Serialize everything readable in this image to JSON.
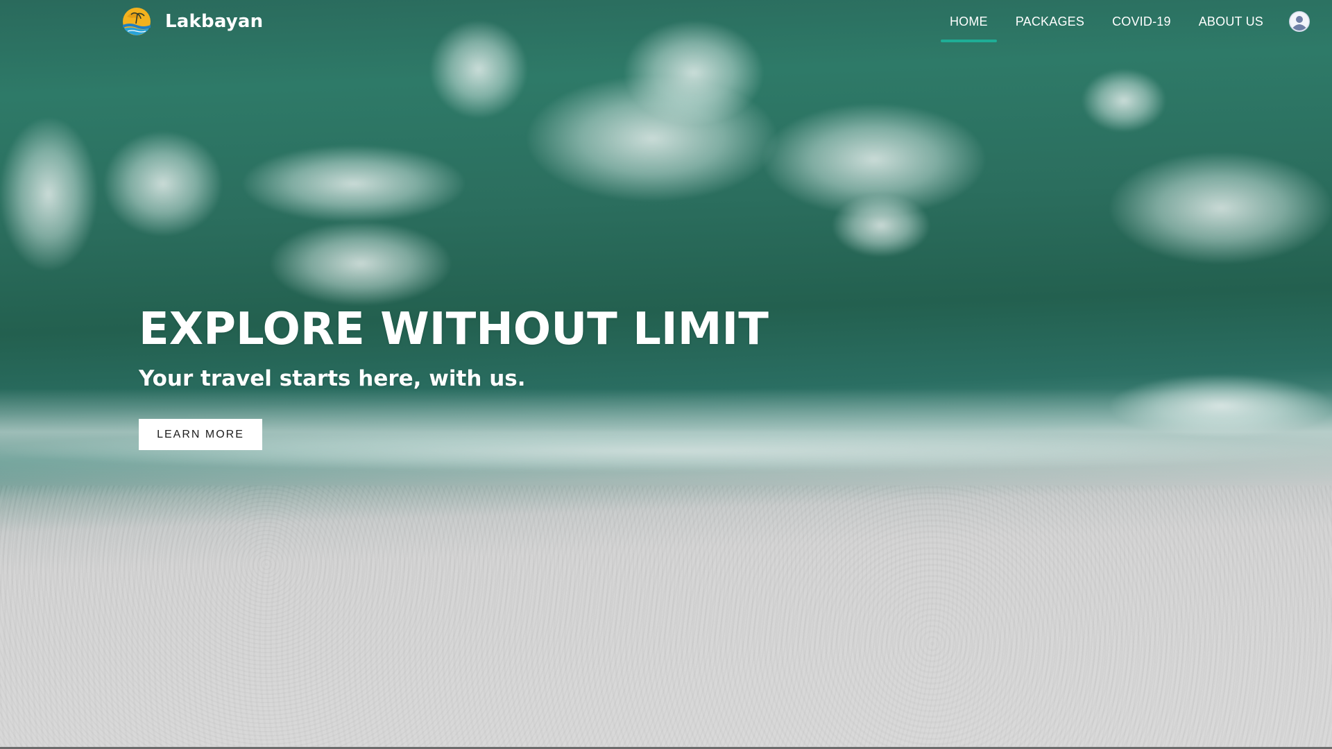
{
  "brand": {
    "name": "Lakbayan",
    "logo_icon": "sun-over-sea-logo-icon"
  },
  "nav": {
    "items": [
      {
        "label": "HOME",
        "active": true
      },
      {
        "label": "PACKAGES",
        "active": false
      },
      {
        "label": "COVID-19",
        "active": false
      },
      {
        "label": "ABOUT US",
        "active": false
      }
    ],
    "avatar_icon": "user-avatar-icon",
    "active_color": "#1fae96"
  },
  "hero": {
    "title": "EXPLORE WITHOUT LIMIT",
    "subtitle": "Your travel starts here, with us.",
    "cta_label": "LEARN MORE",
    "background": "aerial-beach-waves-image"
  }
}
